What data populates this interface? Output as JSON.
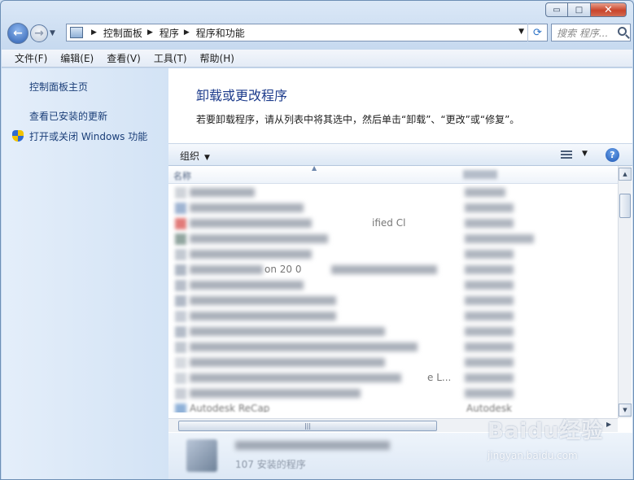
{
  "window": {
    "minimize_glyph": "▭",
    "maximize_glyph": "□",
    "close_glyph": "✕"
  },
  "nav": {
    "back_glyph": "←",
    "forward_glyph": "→",
    "breadcrumbs": [
      "控制面板",
      "程序",
      "程序和功能"
    ],
    "search_placeholder": "搜索 程序..."
  },
  "menu": [
    "文件(F)",
    "编辑(E)",
    "查看(V)",
    "工具(T)",
    "帮助(H)"
  ],
  "sidebar": {
    "home": "控制面板主页",
    "view_updates": "查看已安装的更新",
    "windows_features": "打开或关闭 Windows 功能"
  },
  "main": {
    "title": "卸载或更改程序",
    "description": "若要卸载程序，请从列表中将其选中，然后单击“卸载”、“更改”或“修复”。",
    "organize": "组织",
    "column_name": "名称",
    "help_glyph": "?"
  },
  "programs": {
    "partial_texts": {
      "row3": "ified Cl",
      "row6": "on 20 0",
      "row13": "e L...",
      "row15_name": "Autodesk ReCap",
      "row15_publisher": "Autodesk"
    }
  },
  "details": {
    "installed_count": "107 安装的程序"
  },
  "watermark": {
    "brand": "Baidu经验",
    "url": "jingyan.baidu.com"
  },
  "colors": {
    "link": "#1a3e78",
    "title": "#1e3c8c",
    "accent": "#2f6ad2"
  }
}
